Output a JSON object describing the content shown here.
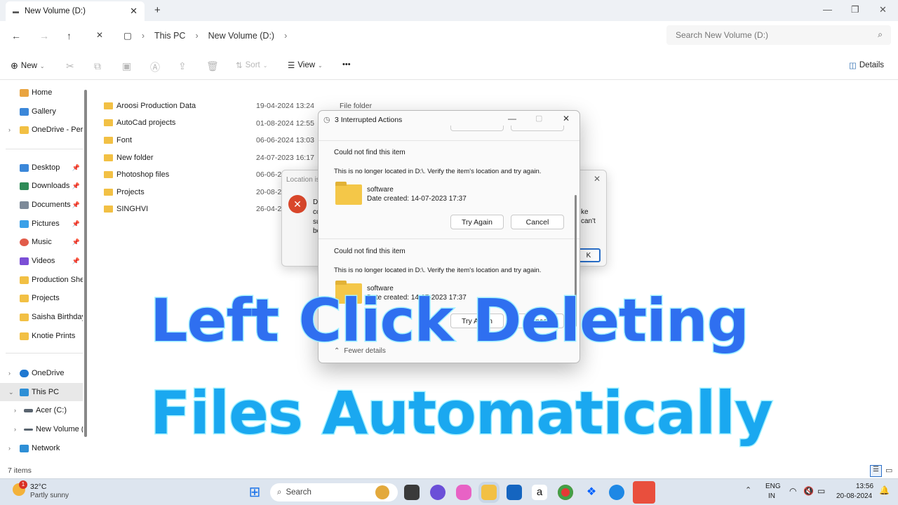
{
  "window": {
    "tab_title": "New Volume (D:)"
  },
  "address": {
    "crumbs": [
      "This PC",
      "New Volume (D:)"
    ],
    "search_placeholder": "Search New Volume (D:)"
  },
  "commands": {
    "new": "New",
    "sort": "Sort",
    "view": "View",
    "more": "•••",
    "details": "Details"
  },
  "sidebar": {
    "items": [
      "Home",
      "Gallery",
      "OneDrive - Perso",
      "Desktop",
      "Downloads",
      "Documents",
      "Pictures",
      "Music",
      "Videos",
      "Production Shee",
      "Projects",
      "Saisha Birthday",
      "Knotie Prints",
      "OneDrive",
      "This PC",
      "Acer (C:)",
      "New Volume (I",
      "Network"
    ]
  },
  "files": [
    {
      "name": "Aroosi Production Data",
      "date": "19-04-2024 13:24",
      "type": "File folder"
    },
    {
      "name": "AutoCad projects",
      "date": "01-08-2024 12:55"
    },
    {
      "name": "Font",
      "date": "06-06-2024 13:03"
    },
    {
      "name": "New folder",
      "date": "24-07-2023 16:17"
    },
    {
      "name": "Photoshop files",
      "date": "06-06-20"
    },
    {
      "name": "Projects",
      "date": "20-08-20"
    },
    {
      "name": "SINGHVI",
      "date": "26-04-20"
    }
  ],
  "status": {
    "items": "7 items"
  },
  "bg_dialog": {
    "title": "Location is",
    "l1": "D",
    "l2": "cc",
    "l3": "su",
    "l4": "be",
    "r1": "ke",
    "r2": "can't",
    "ok": "K"
  },
  "dialog": {
    "title": "3 Interrupted Actions",
    "entries": [
      {
        "heading": "Could not find this item",
        "message": "This is no longer located in D:\\. Verify the item's location and try again.",
        "name": "software",
        "date": "Date created: 14-07-2023 17:37",
        "try": "Try Again",
        "cancel": "Cancel"
      },
      {
        "heading": "Could not find this item",
        "message": "This is no longer located in D:\\. Verify the item's location and try again.",
        "name": "software",
        "date": "Date created: 14-07-2023 17:37",
        "try": "Try Again",
        "cancel": "Cancel"
      }
    ],
    "fewer": "Fewer details"
  },
  "overlay": {
    "line1": "Left Click Deleting",
    "line2": "Files Automatically",
    "colors": [
      "#2f6ff0",
      "#18c8f0"
    ]
  },
  "taskbar": {
    "temp": "32°C",
    "weather": "Partly sunny",
    "badge": "1",
    "search": "Search",
    "lang1": "ENG",
    "lang2": "IN",
    "time": "13:56",
    "date": "20-08-2024"
  }
}
